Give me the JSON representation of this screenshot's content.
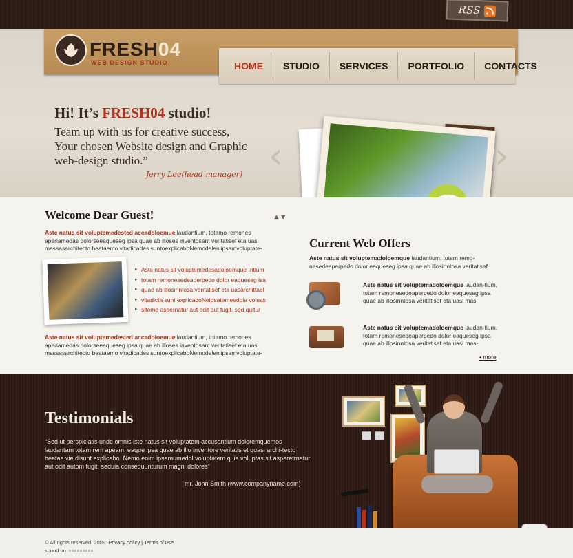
{
  "rss": {
    "label": "RSS"
  },
  "logo": {
    "name": "FRESH",
    "number": "04",
    "tagline": "WEB DESIGN STUDIO"
  },
  "nav": {
    "items": [
      {
        "label": "HOME",
        "active": true
      },
      {
        "label": "STUDIO"
      },
      {
        "label": "SERVICES"
      },
      {
        "label": "PORTFOLIO"
      },
      {
        "label": "CONTACTS"
      }
    ]
  },
  "hero": {
    "title_prefix": "Hi! It’s ",
    "title_brand": "FRESH",
    "title_brand_num": "04",
    "title_suffix": " studio!",
    "text": "Team up with us for creative success, Your chosen Website design and Graphic web-design studio.”",
    "signature": "Jerry Lee(head manager)"
  },
  "welcome": {
    "title": "Welcome Dear Guest!",
    "para1_bold": "Aste natus sit voluptemedested accadoloemue",
    "para1_text": " laudantium, totamo remones aperiamedas dolorseeaqueseg ipsa quae ab illoses inventosant veritatisef eta uasi massasarchitecto beataemo vitadicades suntoexplicaboNemodeleniipsamvoluptate-",
    "links": [
      "Aste natus sit voluptemedesadoloemque Intium",
      "totam remonesedeaperpedo dolor eaqueseg isa",
      "quae ab illosinntosa veritatisef eta uasarchittael",
      "vitadicta sunt explicaboNeipsatemeedqia voluas",
      "sitome aspernatur aut odit aut fugit, sed quitur"
    ],
    "para2_bold": "Aste natus sit voluptemedested accadoloemue",
    "para2_text": " laudantium, totamo remones aperiamedas dolorseeaqueseg ipsa quae ab illoses inventosant veritatisef eta uasi massasarchitecto beataemo vitadicades suntoexplicaboNemodeleniipsamvoluptate-"
  },
  "offers": {
    "title": "Current Web Offers",
    "intro_bold": "Aste natus sit voluptemadoloemque",
    "intro_text": " laudantium, totam remo-nesedeaperpedo dolor eaqueseg ipsa quae ab illosinntosa veritatisef",
    "items": [
      {
        "icon": "box-gear-icon",
        "bold": "Aste natus sit voluptemadoloemque",
        "text": " laudan-tium, totam remonesedeaperpedo dolor eaqueseg ipsa quae ab illosinntosa veritatisef eta uasi mas-"
      },
      {
        "icon": "briefcase-icon",
        "bold": "Aste natus sit voluptemadoloemque",
        "text": " laudan-tium, totam remonesedeaperpedo dolor eaqueseg ipsa quae ab illosinntosa veritatisef eta uasi mas-"
      }
    ],
    "more_label": "more"
  },
  "testimonials": {
    "title": "Testimonials",
    "quote": "“Sed ut perspiciatis unde omnis iste natus sit voluptatem accusantium doloremquemos laudantam totam rem apeam, eaque ipsa quae ab illo inventore veritatis et quasi archi-tecto beatae vie disunt explicabo. Nemo enim ipsamumedol voluptatem quia voluptas sit asperetrnatur aut odit autom fugit, seduia consequunturum magni dolores”",
    "author": "mr. John Smith (www.companyname.com)"
  },
  "footer": {
    "copyright": "© All rights reserved. 2009.",
    "privacy": "Privacy policy",
    "separator": "|",
    "terms": "Terms of use",
    "sound_label": "sound on"
  },
  "colors": {
    "accent_red": "#b8301a",
    "dark_brown": "#2b1811",
    "tan": "#c79f66"
  }
}
